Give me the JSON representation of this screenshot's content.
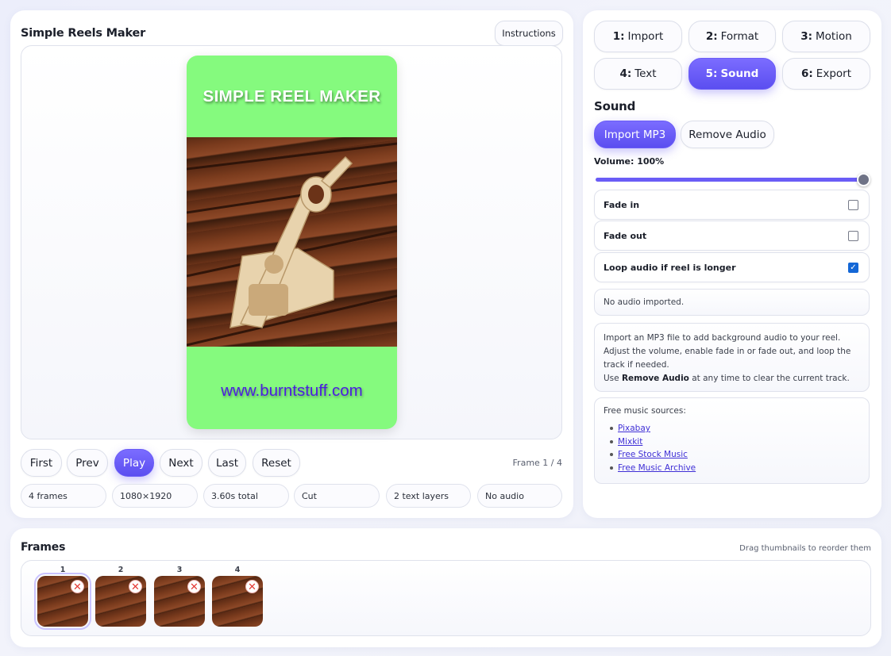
{
  "app": {
    "title": "Simple Reels Maker",
    "instructions_label": "Instructions"
  },
  "reel": {
    "title": "SIMPLE REEL MAKER",
    "url": "www.burntstuff.com",
    "background": "#85fa7e"
  },
  "controls": {
    "first": "First",
    "prev": "Prev",
    "play": "Play",
    "next": "Next",
    "last": "Last",
    "reset": "Reset",
    "frame_counter": "Frame 1 / 4"
  },
  "chips": [
    "4 frames",
    "1080×1920",
    "3.60s total",
    "Cut",
    "2 text layers",
    "No audio"
  ],
  "tabs": [
    {
      "num": "1:",
      "label": "Import",
      "active": false
    },
    {
      "num": "2:",
      "label": "Format",
      "active": false
    },
    {
      "num": "3:",
      "label": "Motion",
      "active": false
    },
    {
      "num": "4:",
      "label": "Text",
      "active": false
    },
    {
      "num": "5:",
      "label": "Sound",
      "active": true
    },
    {
      "num": "6:",
      "label": "Export",
      "active": false
    }
  ],
  "sound": {
    "heading": "Sound",
    "import_label": "Import MP3",
    "remove_label": "Remove Audio",
    "volume_label": "Volume: 100%",
    "volume": 1.0,
    "options": [
      {
        "label": "Fade in",
        "checked": false
      },
      {
        "label": "Fade out",
        "checked": false
      },
      {
        "label": "Loop audio if reel is longer",
        "checked": true
      }
    ],
    "status": "No audio imported.",
    "help_line1": "Import an MP3 file to add background audio to your reel.",
    "help_line2": "Adjust the volume, enable fade in or fade out, and loop the track if needed.",
    "help_line3_prefix": "Use ",
    "help_line3_bold": "Remove Audio",
    "help_line3_suffix": " at any time to clear the current track.",
    "sources_title": "Free music sources:",
    "sources": [
      "Pixabay",
      "Mixkit",
      "Free Stock Music",
      "Free Music Archive"
    ]
  },
  "frames": {
    "title": "Frames",
    "hint": "Drag thumbnails to reorder them",
    "items": [
      {
        "num": "1",
        "selected": true
      },
      {
        "num": "2",
        "selected": false
      },
      {
        "num": "3",
        "selected": false
      },
      {
        "num": "4",
        "selected": false
      }
    ],
    "remove_icon": "close-icon"
  },
  "colors": {
    "accent": "#6a5cf6",
    "link": "#3f2fd6",
    "checkbox": "#1467d6",
    "delete": "#e53935"
  }
}
